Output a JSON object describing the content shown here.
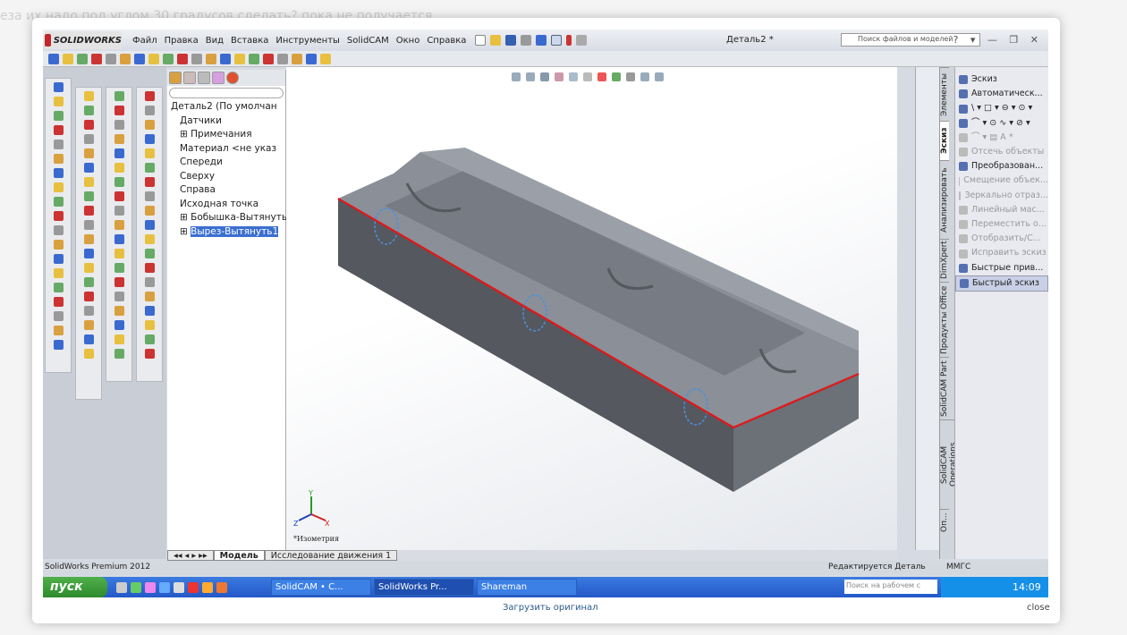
{
  "background": {
    "text": "еза их надо под углом 30 градусов сделать? пока не получается"
  },
  "window": {
    "app": "SOLIDWORKS",
    "title": "Деталь2 *",
    "search_placeholder": "Поиск файлов и моделей",
    "controls": "? ▾ — ❐ ✕"
  },
  "menu": [
    "Файл",
    "Правка",
    "Вид",
    "Вставка",
    "Инструменты",
    "SolidCAM",
    "Окно",
    "Справка"
  ],
  "tree": {
    "root": "Деталь2  (По умолчан",
    "items": [
      {
        "label": "Датчики",
        "expand": false
      },
      {
        "label": "Примечания",
        "expand": true
      },
      {
        "label": "Материал <не указ",
        "expand": false
      },
      {
        "label": "Спереди",
        "expand": false
      },
      {
        "label": "Сверху",
        "expand": false
      },
      {
        "label": "Справа",
        "expand": false
      },
      {
        "label": "Исходная точка",
        "expand": false
      },
      {
        "label": "Бобышка-Вытянуть",
        "expand": true
      },
      {
        "label": "Вырез-Вытянуть1",
        "expand": true,
        "selected": true
      }
    ]
  },
  "viewport": {
    "view_name": "*Изометрия",
    "axes": {
      "x": "X",
      "y": "Y",
      "z": "Z"
    }
  },
  "vertical_tabs": [
    "Элементы",
    "Эскиз",
    "Анализировать",
    "DimXpert",
    "Продукты Office",
    "SolidCAM Part",
    "SolidCAM Operations",
    "Оп..."
  ],
  "active_tab": "Эскиз",
  "command_panel": [
    {
      "label": "Эскиз",
      "enabled": true
    },
    {
      "label": "Автоматическ...",
      "enabled": true
    },
    {
      "label": "\\ ▾ □ ▾ ⊖ ▾ ⊙ ▾",
      "enabled": true
    },
    {
      "label": "⌒ ▾ ⊙   ∿ ▾ ⊘ ▾",
      "enabled": true
    },
    {
      "label": "⌒ ▾ ▤   A   *",
      "enabled": false
    },
    {
      "label": "Отсечь объекты",
      "enabled": false
    },
    {
      "label": "Преобразован...",
      "enabled": true
    },
    {
      "label": "Смещение объек...",
      "enabled": false
    },
    {
      "label": "Зеркально отраз...",
      "enabled": false
    },
    {
      "label": "Линейный мас...",
      "enabled": false
    },
    {
      "label": "Переместить о...",
      "enabled": false
    },
    {
      "label": "Отобразить/С...",
      "enabled": false
    },
    {
      "label": "Исправить эскиз",
      "enabled": false
    },
    {
      "label": "Быстрые прив...",
      "enabled": true
    },
    {
      "label": "Быстрый эскиз",
      "enabled": true,
      "highlighted": true
    }
  ],
  "bottom_tabs": [
    "Модель",
    "Исследование движения 1"
  ],
  "status": {
    "product": "SolidWorks Premium 2012",
    "editing": "Редактируется Деталь",
    "units": "ММГС"
  },
  "taskbar": {
    "start": "пуск",
    "tasks": [
      "SolidCAM • C...",
      "SolidWorks Pr...",
      "Shareman"
    ],
    "search_placeholder": "Поиск на рабочем с",
    "clock": "14:09"
  },
  "footer": {
    "load_original": "Загрузить оригинал",
    "close": "close"
  },
  "colors": {
    "edge_highlight": "#e01818",
    "selection": "#3b6fd0",
    "taskbar": "#2458c8"
  }
}
